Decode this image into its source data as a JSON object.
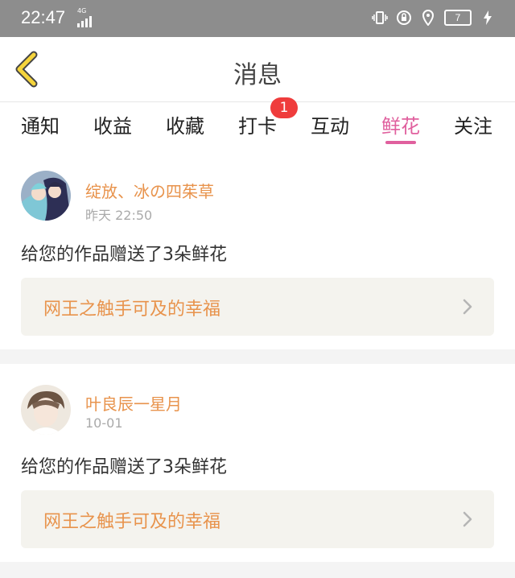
{
  "status_bar": {
    "time": "22:47",
    "network_label": "4G",
    "battery_level": "7"
  },
  "header": {
    "title": "消息"
  },
  "tabs": [
    {
      "label": "通知"
    },
    {
      "label": "收益"
    },
    {
      "label": "收藏"
    },
    {
      "label": "打卡",
      "badge": "1"
    },
    {
      "label": "互动"
    },
    {
      "label": "鲜花",
      "active": true
    },
    {
      "label": "关注"
    }
  ],
  "messages": [
    {
      "username": "绽放、冰の四茱草",
      "time": "昨天 22:50",
      "text": "给您的作品赠送了3朵鲜花",
      "work_title": "网王之触手可及的幸福"
    },
    {
      "username": "叶良辰一星月",
      "time": "10-01",
      "text": "给您的作品赠送了3朵鲜花",
      "work_title": "网王之触手可及的幸福"
    }
  ],
  "colors": {
    "accent_pink": "#e0609e",
    "username_orange": "#e8934c",
    "badge_red": "#ef3c3c"
  }
}
